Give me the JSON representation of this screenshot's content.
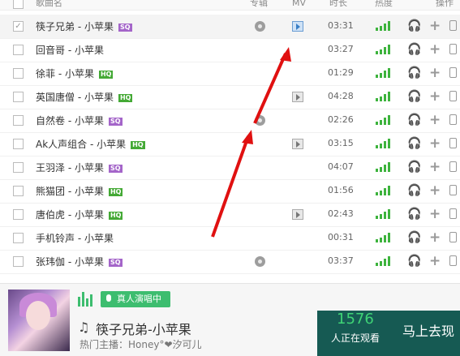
{
  "columns": {
    "name": "歌曲名",
    "album": "专辑",
    "mv": "MV",
    "duration": "时长",
    "popularity": "热度",
    "actions": "操作"
  },
  "colors": {
    "heat": "#3db33d",
    "arrow": "#e01010",
    "sq_badge": "#a465c9",
    "hq_badge": "#44a935",
    "live": "#3dbd6f",
    "watch_bg": "#165a53"
  },
  "songs": [
    {
      "title": "筷子兄弟 - 小苹果",
      "badge": "SQ",
      "album": true,
      "mv": true,
      "duration": "03:31",
      "selected": true
    },
    {
      "title": "回音哥 - 小苹果",
      "badge": "",
      "album": false,
      "mv": false,
      "duration": "03:27",
      "selected": false
    },
    {
      "title": "徐菲 - 小苹果",
      "badge": "HQ",
      "album": false,
      "mv": false,
      "duration": "01:29",
      "selected": false
    },
    {
      "title": "英国唐僧 - 小苹果",
      "badge": "HQ",
      "album": false,
      "mv": true,
      "duration": "04:28",
      "selected": false
    },
    {
      "title": "自然卷 - 小苹果",
      "badge": "SQ",
      "album": true,
      "mv": false,
      "duration": "02:26",
      "selected": false
    },
    {
      "title": "Ak人声组合 - 小苹果",
      "badge": "HQ",
      "album": false,
      "mv": true,
      "duration": "03:15",
      "selected": false
    },
    {
      "title": "王羽泽 - 小苹果",
      "badge": "SQ",
      "album": false,
      "mv": false,
      "duration": "04:07",
      "selected": false
    },
    {
      "title": "熊猫团 - 小苹果",
      "badge": "HQ",
      "album": false,
      "mv": false,
      "duration": "01:56",
      "selected": false
    },
    {
      "title": "唐伯虎 - 小苹果",
      "badge": "HQ",
      "album": false,
      "mv": true,
      "duration": "02:43",
      "selected": false
    },
    {
      "title": "手机铃声 - 小苹果",
      "badge": "",
      "album": false,
      "mv": false,
      "duration": "00:31",
      "selected": false
    },
    {
      "title": "张玮伽 - 小苹果",
      "badge": "SQ",
      "album": true,
      "mv": false,
      "duration": "03:37",
      "selected": false
    }
  ],
  "icons": {
    "album": "disc-icon",
    "mv": "mv-play-icon",
    "listen": "headphones-icon",
    "add": "plus-icon",
    "phone": "phone-icon"
  },
  "player": {
    "live_button": "真人演唱中",
    "song_title": "筷子兄弟-小苹果",
    "host": "热门主播：Honey°❤汐可儿",
    "viewer_count": "1576",
    "viewer_label": "人正在观看",
    "watch_button": "马上去现"
  }
}
